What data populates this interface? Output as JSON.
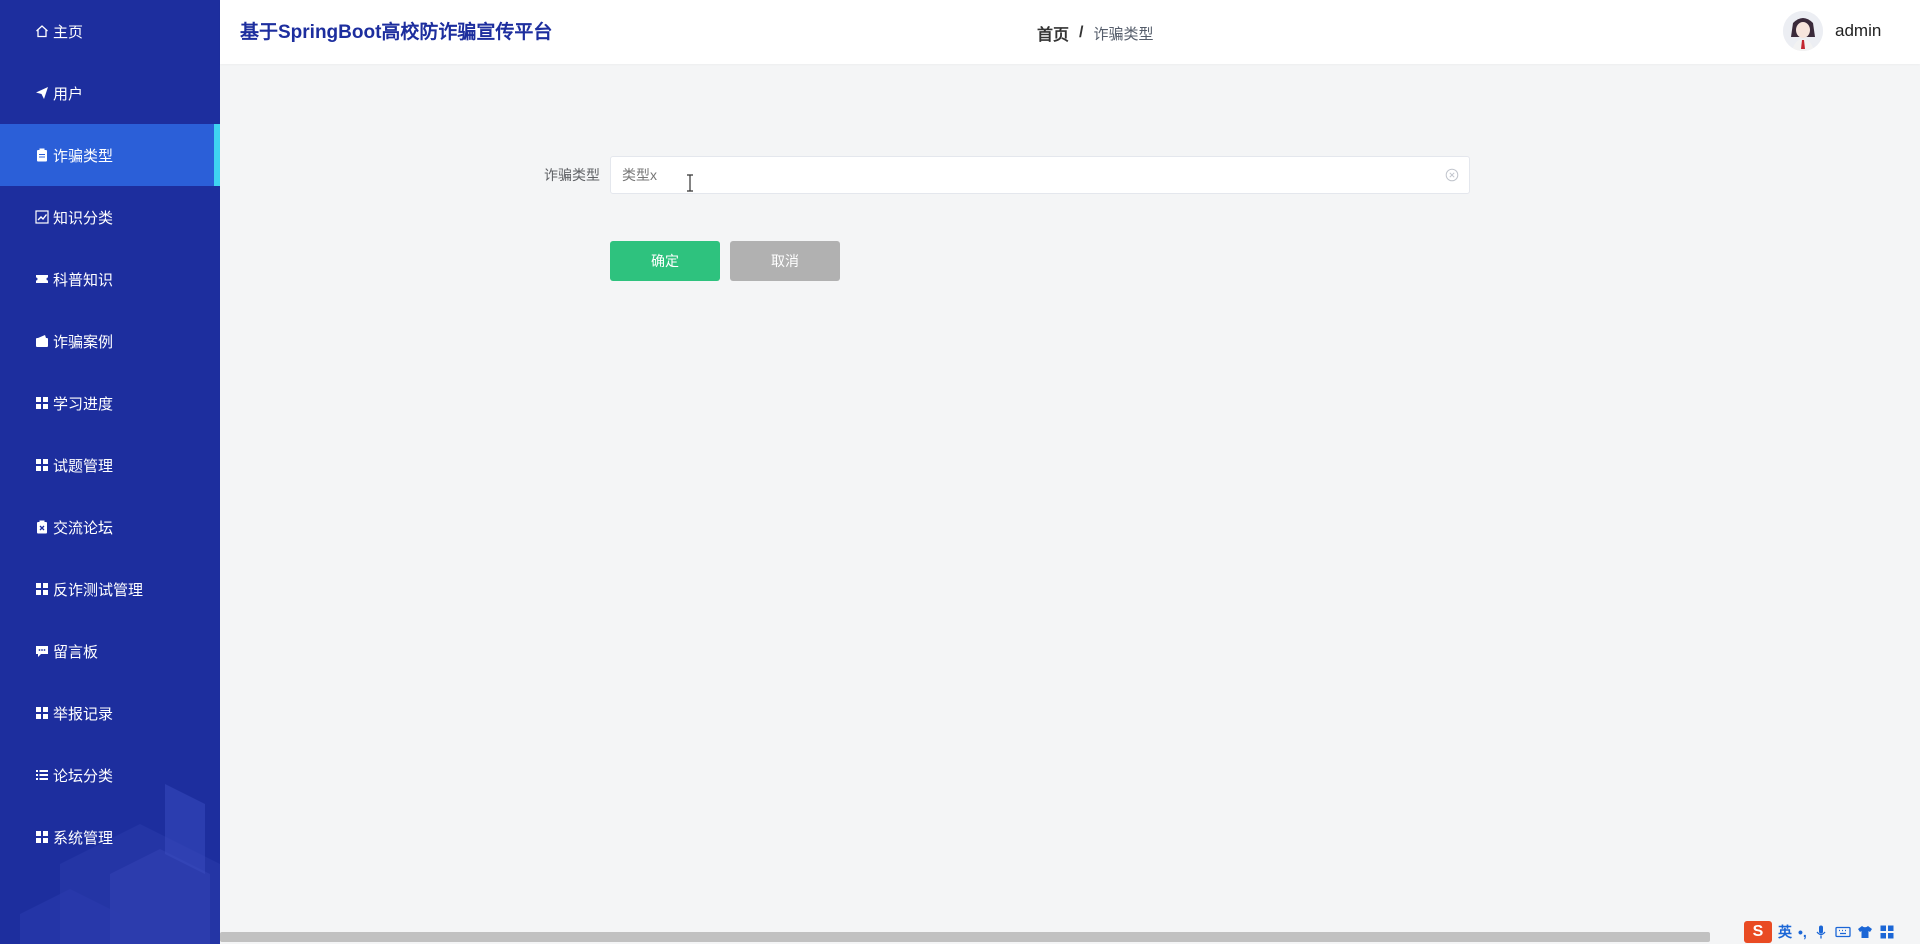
{
  "header": {
    "site_title": "基于SpringBoot高校防诈骗宣传平台",
    "breadcrumb": {
      "home": "首页",
      "separator": "/",
      "current": "诈骗类型"
    },
    "username": "admin"
  },
  "sidebar": {
    "items": [
      {
        "label": "主页",
        "icon": "home-icon"
      },
      {
        "label": "用户",
        "icon": "send-icon"
      },
      {
        "label": "诈骗类型",
        "icon": "clipboard-icon",
        "active": true
      },
      {
        "label": "知识分类",
        "icon": "chart-icon"
      },
      {
        "label": "科普知识",
        "icon": "ticket-icon"
      },
      {
        "label": "诈骗案例",
        "icon": "wallet-icon"
      },
      {
        "label": "学习进度",
        "icon": "grid-icon"
      },
      {
        "label": "试题管理",
        "icon": "grid-icon"
      },
      {
        "label": "交流论坛",
        "icon": "clipboard-x-icon"
      },
      {
        "label": "反诈测试管理",
        "icon": "grid-icon"
      },
      {
        "label": "留言板",
        "icon": "comment-icon"
      },
      {
        "label": "举报记录",
        "icon": "grid-icon"
      },
      {
        "label": "论坛分类",
        "icon": "list-icon"
      },
      {
        "label": "系统管理",
        "icon": "grid-icon"
      }
    ]
  },
  "form": {
    "label": "诈骗类型",
    "value": "类型x"
  },
  "buttons": {
    "confirm": "确定",
    "cancel": "取消"
  },
  "ime": {
    "logo": "S",
    "mode": "英",
    "punct": "•,"
  },
  "colors": {
    "sidebar_bg": "#1d2e9e",
    "sidebar_active": "#2b5fd8",
    "active_indicator": "#3fd3f1",
    "title": "#1d2e9e",
    "confirm": "#2ec27e",
    "cancel": "#b1b1b1"
  }
}
